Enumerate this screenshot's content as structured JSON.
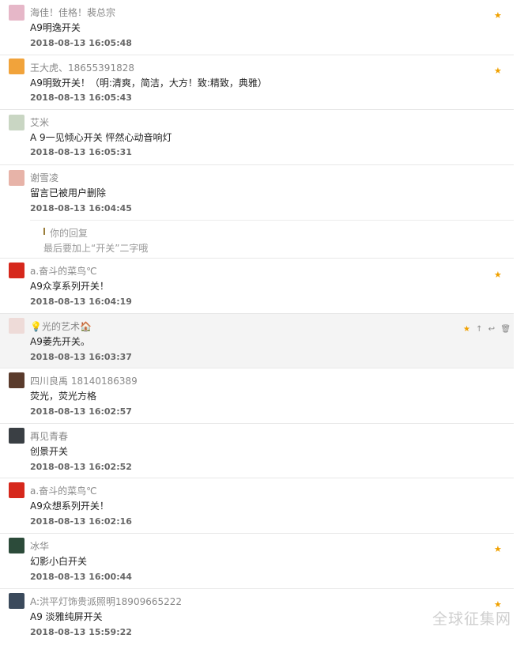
{
  "comments": [
    {
      "name": "海佳！佳格！裴总宗",
      "text": "A9明逸开关",
      "time": "2018-08-13 16:05:48",
      "starred": true,
      "avatar_color": "#e6b7c8",
      "avatar": "avatar-pink-icon"
    },
    {
      "name": "王大虎、18655391828",
      "text": "A9明致开关！（明:清爽，简洁，大方！致:精致，典雅）",
      "time": "2018-08-13 16:05:43",
      "starred": true,
      "avatar_color": "#f1a33b",
      "avatar": "tiger-avatar-icon"
    },
    {
      "name": "艾米",
      "text": "A 9一见倾心开关 怦然心动音响灯",
      "time": "2018-08-13 16:05:31",
      "starred": false,
      "avatar_color": "#c9d6c3",
      "avatar": "avatar-person-icon"
    },
    {
      "name": "谢雪凌",
      "text": "留言已被用户删除",
      "time": "2018-08-13 16:04:45",
      "starred": false,
      "avatar_color": "#e7b3a8",
      "avatar": "avatar-person-icon"
    },
    {
      "name": "a.奋斗的菜鸟℃",
      "text": "A9众享系列开关！",
      "time": "2018-08-13 16:04:19",
      "starred": true,
      "avatar_color": "#d6281c",
      "avatar": "flag-avatar-icon"
    },
    {
      "name": "💡光的艺术🏠",
      "text": "A9萎先开关。",
      "time": "2018-08-13 16:03:37",
      "starred": false,
      "avatar_color": "#eedbd8",
      "avatar": "avatar-light-icon"
    },
    {
      "name": "四川良禹 18140186389",
      "text": "荧光，荧光方格",
      "time": "2018-08-13 16:02:57",
      "starred": false,
      "avatar_color": "#5a3b2c",
      "avatar": "avatar-dark-icon"
    },
    {
      "name": "再见青春",
      "text": "创景开关",
      "time": "2018-08-13 16:02:52",
      "starred": false,
      "avatar_color": "#3a3f44",
      "avatar": "avatar-dark-icon"
    },
    {
      "name": "a.奋斗的菜鸟℃",
      "text": "A9众想系列开关！",
      "time": "2018-08-13 16:02:16",
      "starred": false,
      "avatar_color": "#d6281c",
      "avatar": "flag-avatar-icon"
    },
    {
      "name": "冰华",
      "text": "幻影小白开关",
      "time": "2018-08-13 16:00:44",
      "starred": true,
      "avatar_color": "#2c4b3a",
      "avatar": "avatar-person-icon"
    },
    {
      "name": "A:洪平灯饰贵派照明18909665222",
      "text": "A9 淡雅纯屏开关",
      "time": "2018-08-13 15:59:22",
      "starred": true,
      "avatar_color": "#3b4a5c",
      "avatar": "avatar-building-icon"
    }
  ],
  "reply": {
    "label": "你的回复",
    "text": "最后要加上“开关”二字哦"
  },
  "actions": {
    "star": "★",
    "top": "↑",
    "reply": "↩",
    "delete": "🗑"
  },
  "star_glyph": "★",
  "watermark": "全球征集网"
}
